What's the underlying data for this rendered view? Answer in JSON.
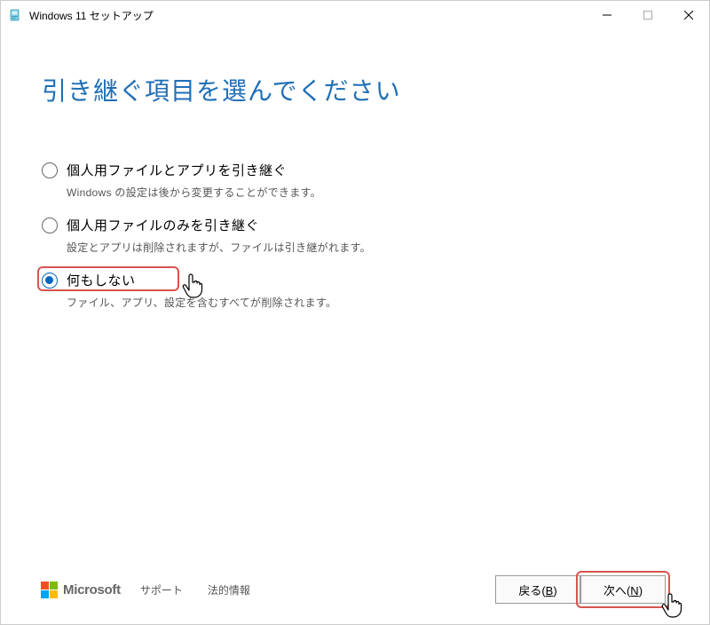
{
  "window": {
    "title": "Windows 11 セットアップ"
  },
  "page": {
    "heading": "引き継ぐ項目を選んでください"
  },
  "options": [
    {
      "label": "個人用ファイルとアプリを引き継ぐ",
      "desc": "Windows の設定は後から変更することができます。",
      "checked": false
    },
    {
      "label": "個人用ファイルのみを引き継ぐ",
      "desc": "設定とアプリは削除されますが、ファイルは引き継がれます。",
      "checked": false
    },
    {
      "label": "何もしない",
      "desc": "ファイル、アプリ、設定を含むすべてが削除されます。",
      "checked": true
    }
  ],
  "footer": {
    "brand": "Microsoft",
    "support": "サポート",
    "legal": "法的情報",
    "back_label_pre": "戻る(",
    "back_key": "B",
    "back_label_post": ")",
    "next_label_pre": "次へ(",
    "next_key": "N",
    "next_label_post": ")"
  },
  "colors": {
    "accent": "#0067c0",
    "heading": "#1f6fb7",
    "highlight": "#d9534f"
  }
}
